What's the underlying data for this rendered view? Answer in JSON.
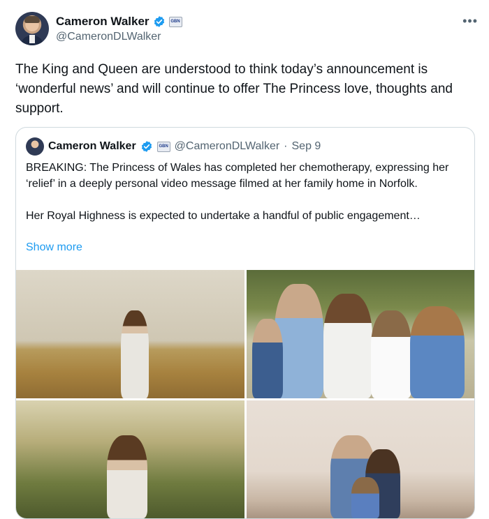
{
  "tweet": {
    "author": {
      "display_name": "Cameron Walker",
      "handle": "@CameronDLWalker",
      "badge_text": "GBN"
    },
    "more_label": "•••",
    "text": "The King and Queen are understood to think today’s announcement is ‘wonderful news’ and will continue to offer The Princess love, thoughts and support."
  },
  "quoted_tweet": {
    "author": {
      "display_name": "Cameron Walker",
      "handle": "@CameronDLWalker",
      "badge_text": "GBN"
    },
    "separator": "·",
    "date": "Sep 9",
    "paragraphs": [
      "BREAKING: The Princess of Wales has completed her chemotherapy, expressing her ‘relief’ in a deeply personal video message filmed at her family home in Norfolk.",
      "Her Royal Highness is expected to undertake a handful of public engagement…"
    ],
    "show_more_label": "Show more"
  },
  "colors": {
    "text_primary": "#0f1419",
    "text_secondary": "#536471",
    "link": "#1d9bf0",
    "verified": "#1d9bf0",
    "border": "#cfd9de"
  },
  "icons": {
    "verified": "verified-badge-icon",
    "more": "more-dots-icon",
    "affiliate": "gb-news-badge-icon"
  }
}
